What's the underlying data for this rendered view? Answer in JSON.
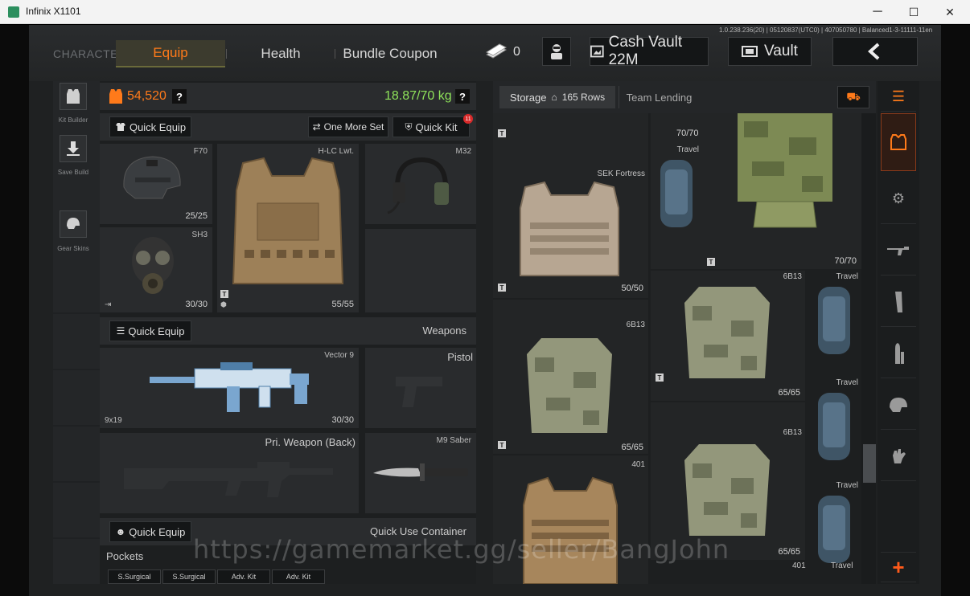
{
  "window": {
    "title": "Infinix X1101",
    "minimize": "─",
    "maximize": "☐",
    "close": "✕"
  },
  "server_info": "1.0.238.236(20) | 05120837(UTC0) | 407050780 | Balanced1-3-11111-11en",
  "nav": {
    "character": "CHARACTER",
    "tabs": [
      "Equip",
      "Health",
      "Bundle Coupon"
    ],
    "cash_count": "0",
    "cash_vault": "Cash Vault 22M",
    "vault": "Vault",
    "back_icon": "chevron-left-icon"
  },
  "left_rail": [
    {
      "label": "Kit Builder",
      "icon": "vest-icon"
    },
    {
      "label": "Save Build",
      "icon": "download-icon"
    },
    {
      "label": "Gear Skins",
      "icon": "helmet-icon"
    }
  ],
  "equip": {
    "value": "54,520",
    "weight": "18.87/70 kg",
    "help": "?",
    "quick_equip": "Quick Equip",
    "one_more_set": "One More Set",
    "quick_kit": "Quick Kit",
    "quick_kit_badge": "11",
    "gear": {
      "helmet": {
        "name": "F70",
        "durability": "25/25"
      },
      "mask": {
        "name": "SH3",
        "durability": "30/30"
      },
      "armor": {
        "name": "H-LC Lwt.",
        "durability": "55/55"
      },
      "headset": {
        "name": "M32"
      }
    },
    "weapons_label": "Weapons",
    "weapons": {
      "primary": {
        "name": "Vector 9",
        "ammo": "9x19",
        "durability": "30/30"
      },
      "pistol": {
        "label": "Pistol"
      },
      "back": {
        "label": "Pri. Weapon (Back)"
      },
      "melee": {
        "name": "M9 Saber"
      }
    },
    "container_label": "Quick Use Container",
    "pockets_label": "Pockets",
    "pockets": [
      "S.Surgical",
      "S.Surgical",
      "Adv. Kit",
      "Adv. Kit"
    ]
  },
  "storage": {
    "tab_storage": "Storage",
    "rows": "165 Rows",
    "tab_team": "Team Lending",
    "items": {
      "top_dur": "70/70",
      "travel_1": "Travel",
      "big_vest_dur": "70/70",
      "sek_name": "SEK Fortress",
      "sek_dur": "50/50",
      "travel_2": "Travel",
      "g6b13_a_name": "6B13",
      "g6b13_b_name": "6B13",
      "g6b13_b_dur": "65/65",
      "g6b13_c_name": "6B13",
      "travel_3": "Travel",
      "g6b13_a_dur": "65/65",
      "g401_name": "401",
      "g6b13_c_dur": "65/65",
      "travel_4": "Travel",
      "g401b_name": "401",
      "travel_5": "Travel"
    }
  },
  "categories": [
    "armor-icon",
    "vest-icon",
    "bag-icon",
    "rifle-icon",
    "magazine-icon",
    "ammo-icon",
    "helmet-icon",
    "glove-icon",
    "add-icon"
  ],
  "watermark": "https://gamemarket.gg/seller/BangJohn",
  "colors": {
    "accent": "#ff7a1a",
    "weight_green": "#8fe35a",
    "badge_red": "#d82a2a"
  }
}
